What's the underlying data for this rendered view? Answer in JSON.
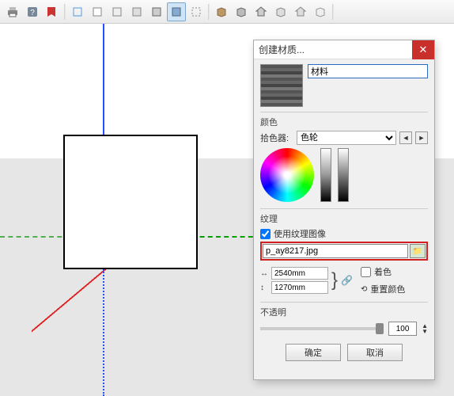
{
  "dialog": {
    "title": "创建材质...",
    "material_name": "材料",
    "section_color": "颜色",
    "picker_label": "拾色器:",
    "picker_value": "色轮",
    "section_texture": "纹理",
    "use_texture_image": "使用纹理图像",
    "texture_file": "p_ay8217.jpg",
    "width_value": "2540mm",
    "height_value": "1270mm",
    "colorize": "着色",
    "reset_color": "重置颜色",
    "section_opacity": "不透明",
    "opacity_value": "100",
    "ok": "确定",
    "cancel": "取消"
  },
  "toolbar_icons": [
    "printer-icon",
    "help-icon",
    "info-icon",
    "",
    "select-icon",
    "measure-icon",
    "move-icon",
    "rotate-icon",
    "scale-icon",
    "offset-icon",
    "layers-icon",
    "",
    "component-icon",
    "box-icon",
    "house-icon",
    "group-icon",
    "house2-icon",
    "explode-icon",
    ""
  ]
}
